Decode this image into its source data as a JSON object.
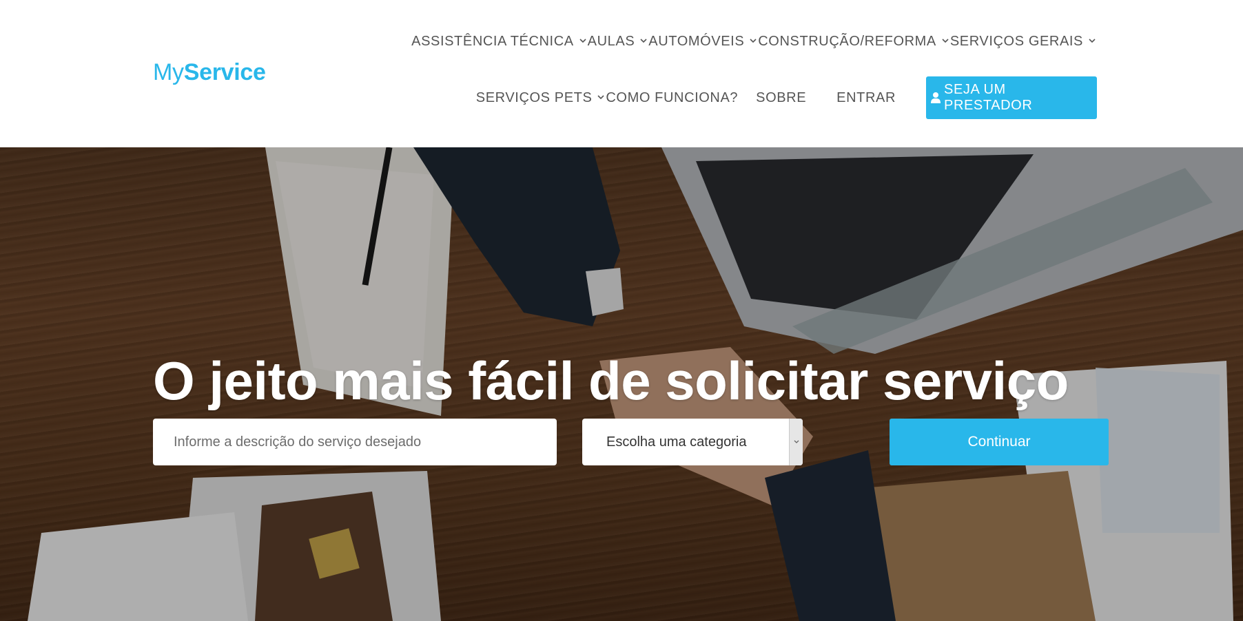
{
  "brand": {
    "prefix": "My",
    "name": "Service",
    "color": "#29b7ea"
  },
  "nav": {
    "row1": [
      {
        "label": "ASSISTÊNCIA TÉCNICA",
        "dropdown": true
      },
      {
        "label": "AULAS",
        "dropdown": true
      },
      {
        "label": "AUTOMÓVEIS",
        "dropdown": true
      },
      {
        "label": "CONSTRUÇÃO/REFORMA",
        "dropdown": true
      },
      {
        "label": "SERVIÇOS GERAIS",
        "dropdown": true
      }
    ],
    "row2": [
      {
        "label": "SERVIÇOS PETS",
        "dropdown": true
      },
      {
        "label": "COMO FUNCIONA?",
        "dropdown": false
      },
      {
        "label": "SOBRE",
        "dropdown": false
      },
      {
        "label": "ENTRAR",
        "dropdown": false
      }
    ],
    "cta_label": "SEJA UM PRESTADOR",
    "cta_icon": "user-icon"
  },
  "hero": {
    "headline": "O jeito mais fácil de solicitar serviço",
    "search_placeholder": "Informe a descrição do serviço desejado",
    "category_selected": "Escolha uma categoria",
    "continue_label": "Continuar"
  },
  "colors": {
    "accent": "#29b7ea",
    "nav_text": "#555555"
  }
}
